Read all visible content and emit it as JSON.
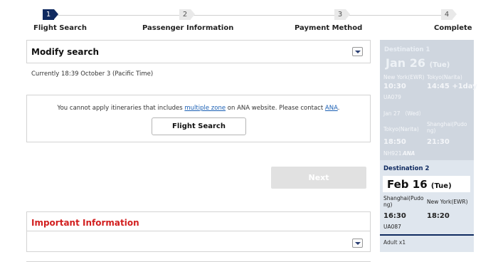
{
  "steps": [
    {
      "num": "1",
      "label": "Flight Search",
      "active": true
    },
    {
      "num": "2",
      "label": "Passenger Information",
      "active": false
    },
    {
      "num": "3",
      "label": "Payment Method",
      "active": false
    },
    {
      "num": "4",
      "label": "Complete",
      "active": false
    }
  ],
  "modify_search": {
    "title": "Modify search",
    "icon": "chevron-down-icon"
  },
  "current_time": "Currently 18:39 October 3 (Pacific Time)",
  "notice": {
    "text_before": "You cannot apply itineraries that includes ",
    "link1": "multiple zone",
    "text_middle": " on ANA website. Please contact ",
    "link2": "ANA",
    "text_after": ".",
    "button": "Flight Search"
  },
  "next_button": "Next",
  "important": {
    "title": "Important Information",
    "icon": "chevron-down-icon"
  },
  "sidebar": {
    "dest1": {
      "heading": "Destination 1",
      "date": "Jan 26",
      "day": "(Tue)",
      "seg1_from": "New York(EWR)",
      "seg1_to": "Tokyo(Narita)",
      "seg1_dep": "10:30",
      "seg1_arr": "14:45 +1day",
      "seg1_flight": "UA079",
      "next_date": "Jan 27 （Wed）",
      "seg2_from": "Tokyo(Narita)",
      "seg2_to_line1": "Shanghai(Pudo",
      "seg2_to_line2": "ng)",
      "seg2_dep": "18:50",
      "seg2_arr": "21:30",
      "seg2_flight": "NH921",
      "airline_logo": "ANA"
    },
    "dest2": {
      "heading": "Destination 2",
      "date": "Feb 16",
      "day": "(Tue)",
      "from_line1": "Shanghai(Pudo",
      "from_line2": "ng)",
      "to": "New York(EWR)",
      "dep": "16:30",
      "arr": "18:20",
      "flight": "UA087"
    },
    "passengers": "Adult x1"
  },
  "colors": {
    "accent": "#0f2a60",
    "important": "#d21f1f",
    "link": "#1a5fb4",
    "sidebar": "#dfe6ee"
  }
}
